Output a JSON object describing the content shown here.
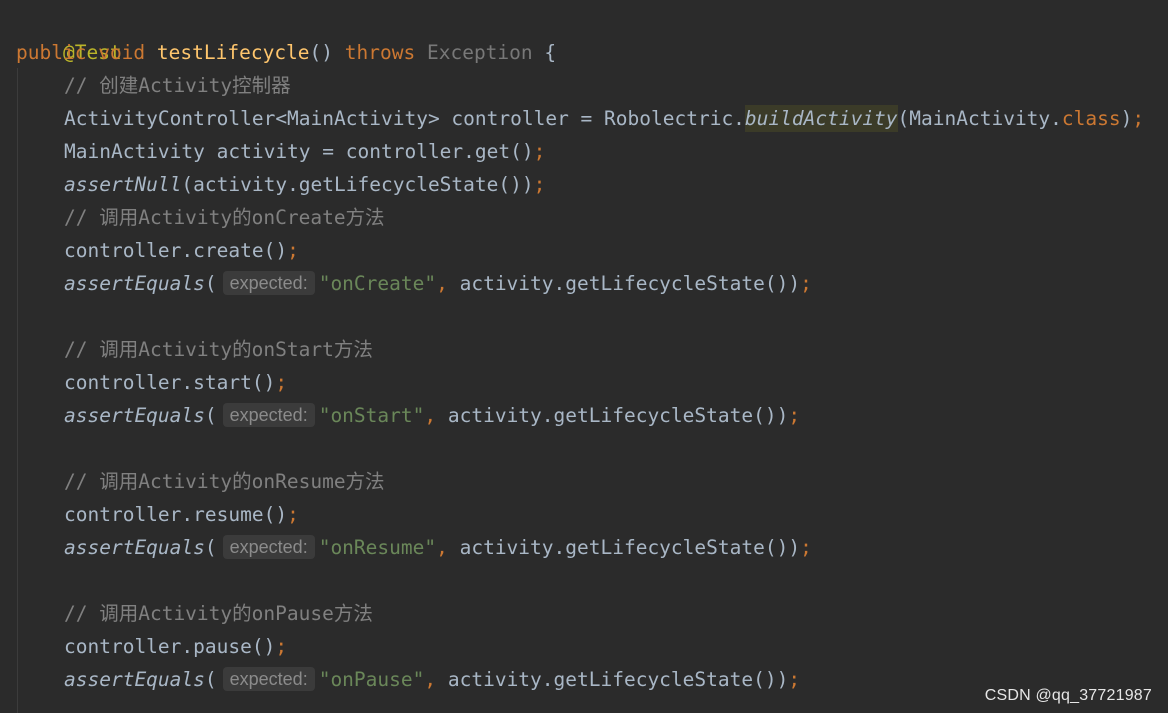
{
  "code": {
    "l1": {
      "annotation": "@Test"
    },
    "l2": {
      "kw_public": "public",
      "kw_void": "void",
      "method_name": "testLifecycle",
      "parens": "()",
      "kw_throws": "throws",
      "exception": "Exception",
      "brace": " {"
    },
    "l3": {
      "comment": "// 创建Activity控制器"
    },
    "l4": {
      "part1": "ActivityController<MainActivity> controller = Robolectric.",
      "method": "buildActivity",
      "part2": "(MainActivity.",
      "kw_class": "class",
      "part3": ")",
      "semi": ";"
    },
    "l5": {
      "text": "MainActivity activity = controller.get()",
      "semi": ";"
    },
    "l6": {
      "method": "assertNull",
      "text": "(activity.getLifecycleState())",
      "semi": ";"
    },
    "l7": {
      "comment": "// 调用Activity的onCreate方法"
    },
    "l8": {
      "text": "controller.create()",
      "semi": ";"
    },
    "l9": {
      "method": "assertEquals",
      "open": "(",
      "hint": "expected:",
      "str": "\"onCreate\"",
      "comma": ",",
      "rest": " activity.getLifecycleState())",
      "semi": ";"
    },
    "l10": {
      "comment": "// 调用Activity的onStart方法"
    },
    "l11": {
      "text": "controller.start()",
      "semi": ";"
    },
    "l12": {
      "method": "assertEquals",
      "open": "(",
      "hint": "expected:",
      "str": "\"onStart\"",
      "comma": ",",
      "rest": " activity.getLifecycleState())",
      "semi": ";"
    },
    "l13": {
      "comment": "// 调用Activity的onResume方法"
    },
    "l14": {
      "text": "controller.resume()",
      "semi": ";"
    },
    "l15": {
      "method": "assertEquals",
      "open": "(",
      "hint": "expected:",
      "str": "\"onResume\"",
      "comma": ",",
      "rest": " activity.getLifecycleState())",
      "semi": ";"
    },
    "l16": {
      "comment": "// 调用Activity的onPause方法"
    },
    "l17": {
      "text": "controller.pause()",
      "semi": ";"
    },
    "l18": {
      "method": "assertEquals",
      "open": "(",
      "hint": "expected:",
      "str": "\"onPause\"",
      "comma": ",",
      "rest": " activity.getLifecycleState())",
      "semi": ";"
    }
  },
  "watermark": "CSDN @qq_37721987",
  "colors": {
    "background": "#2b2b2b",
    "keyword": "#cc7832",
    "method_declaration": "#ffc66d",
    "string": "#6a8759",
    "comment": "#808080",
    "annotation": "#bbb529",
    "default_text": "#a9b7c6"
  }
}
